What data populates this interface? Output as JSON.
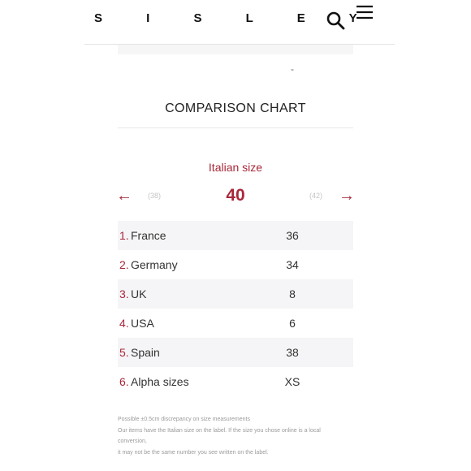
{
  "header": {
    "brand": "S I S L E Y",
    "search_icon": "search-icon",
    "menu_icon": "hamburger-menu-icon"
  },
  "above": {
    "dash": "-"
  },
  "comparison": {
    "title": "COMPARISON CHART",
    "size_label": "Italian size",
    "prev_size": "(38)",
    "current_size": "40",
    "next_size": "(42)",
    "prev_arrow": "←",
    "next_arrow": "→",
    "rows": [
      {
        "num": "1.",
        "country": "France",
        "value": "36"
      },
      {
        "num": "2.",
        "country": "Germany",
        "value": "34"
      },
      {
        "num": "3.",
        "country": "UK",
        "value": "8"
      },
      {
        "num": "4.",
        "country": "USA",
        "value": "6"
      },
      {
        "num": "5.",
        "country": "Spain",
        "value": "38"
      },
      {
        "num": "6.",
        "country": "Alpha sizes",
        "value": "XS"
      }
    ]
  },
  "notes": {
    "line1": "Possible ±0.5cm discrepancy on size measurements",
    "line2": "Our items have the Italian size on the label. If the size you chose online is a local",
    "line3": "conversion,",
    "line4": "it may not be the same number you see written on the label."
  },
  "colors": {
    "accent": "#a8283a",
    "row_shade": "#f5f5f7"
  }
}
